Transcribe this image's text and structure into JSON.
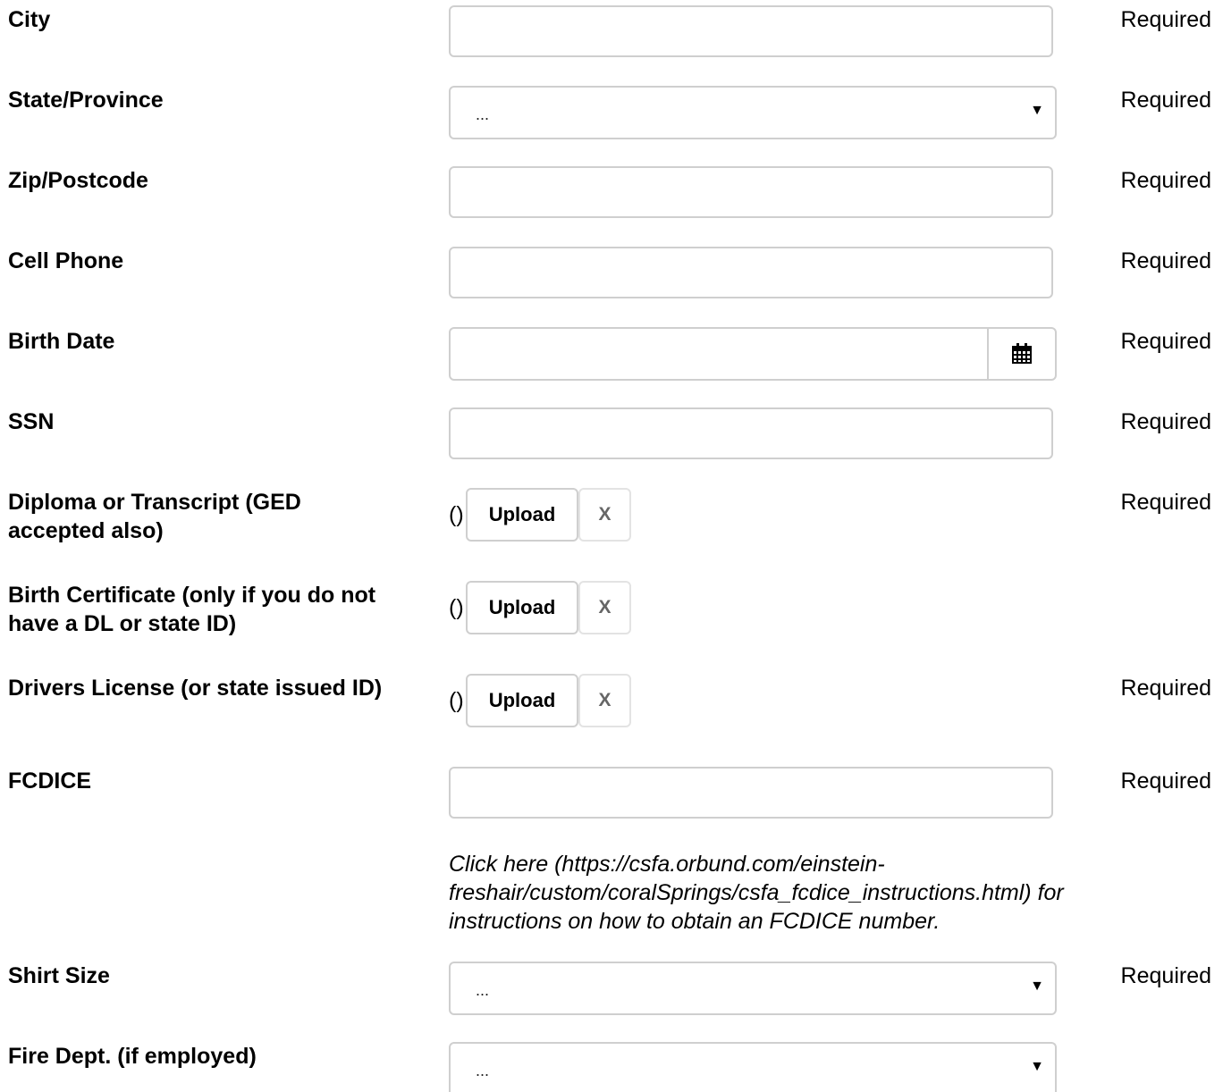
{
  "required_text": "Required",
  "fields": {
    "city": {
      "label": "City"
    },
    "state": {
      "label": "State/Province",
      "value": "..."
    },
    "zip": {
      "label": "Zip/Postcode"
    },
    "cell": {
      "label": "Cell Phone"
    },
    "birth_date": {
      "label": "Birth Date",
      "icon": "calendar-icon"
    },
    "ssn": {
      "label": "SSN"
    },
    "diploma": {
      "label": "Diploma or Transcript (GED accepted also)",
      "paren": "()",
      "upload": "Upload",
      "remove": "X"
    },
    "birth_cert": {
      "label": "Birth Certificate (only if you do not have a DL or state ID)",
      "paren": "()",
      "upload": "Upload",
      "remove": "X"
    },
    "drivers": {
      "label": "Drivers License (or state issued ID)",
      "paren": "()",
      "upload": "Upload",
      "remove": "X"
    },
    "fcdice": {
      "label": "FCDICE",
      "help": "Click here (https://csfa.orbund.com/einstein-freshair/custom/coralSprings/csfa_fcdice_instructions.html) for instructions on how to obtain an FCDICE number."
    },
    "shirt": {
      "label": "Shirt Size",
      "value": "..."
    },
    "fire_dept": {
      "label": "Fire Dept. (if employed)",
      "value": "..."
    }
  }
}
